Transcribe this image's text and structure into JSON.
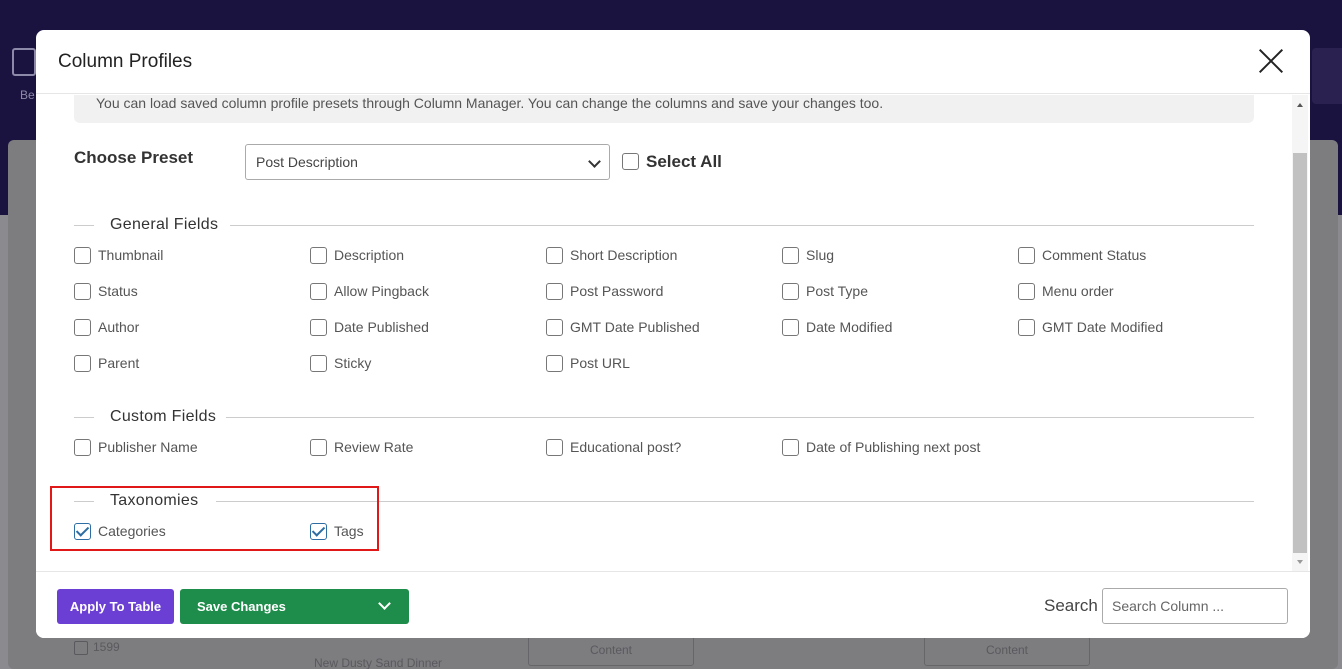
{
  "background": {
    "side_label": "Be",
    "row_id": "1599",
    "row_title": "New Dusty Sand Dinner",
    "content_button": "Content"
  },
  "modal": {
    "title": "Column Profiles",
    "info_text": "You can load saved column profile presets through Column Manager. You can change the columns and save your changes too.",
    "choose_preset_label": "Choose Preset",
    "preset_selected": "Post Description",
    "select_all_label": "Select All",
    "sections": {
      "general": {
        "title": "General Fields",
        "fields": [
          {
            "label": "Thumbnail",
            "checked": false
          },
          {
            "label": "Description",
            "checked": false
          },
          {
            "label": "Short Description",
            "checked": false
          },
          {
            "label": "Slug",
            "checked": false
          },
          {
            "label": "Comment Status",
            "checked": false
          },
          {
            "label": "Status",
            "checked": false
          },
          {
            "label": "Allow Pingback",
            "checked": false
          },
          {
            "label": "Post Password",
            "checked": false
          },
          {
            "label": "Post Type",
            "checked": false
          },
          {
            "label": "Menu order",
            "checked": false
          },
          {
            "label": "Author",
            "checked": false
          },
          {
            "label": "Date Published",
            "checked": false
          },
          {
            "label": "GMT Date Published",
            "checked": false
          },
          {
            "label": "Date Modified",
            "checked": false
          },
          {
            "label": "GMT Date Modified",
            "checked": false
          },
          {
            "label": "Parent",
            "checked": false
          },
          {
            "label": "Sticky",
            "checked": false
          },
          {
            "label": "Post URL",
            "checked": false
          }
        ]
      },
      "custom": {
        "title": "Custom Fields",
        "fields": [
          {
            "label": "Publisher Name",
            "checked": false
          },
          {
            "label": "Review Rate",
            "checked": false
          },
          {
            "label": "Educational post?",
            "checked": false
          },
          {
            "label": "Date of Publishing next post",
            "checked": false
          }
        ]
      },
      "taxonomies": {
        "title": "Taxonomies",
        "fields": [
          {
            "label": "Categories",
            "checked": true
          },
          {
            "label": "Tags",
            "checked": true
          }
        ]
      }
    },
    "footer": {
      "apply_label": "Apply To Table",
      "save_label": "Save Changes",
      "search_label": "Search",
      "search_placeholder": "Search Column ...",
      "search_value": ""
    },
    "colors": {
      "apply_button": "#6c3fd4",
      "save_button": "#1e8c4a",
      "highlight": "#e01818",
      "checkbox_checked": "#2e6da4"
    }
  }
}
